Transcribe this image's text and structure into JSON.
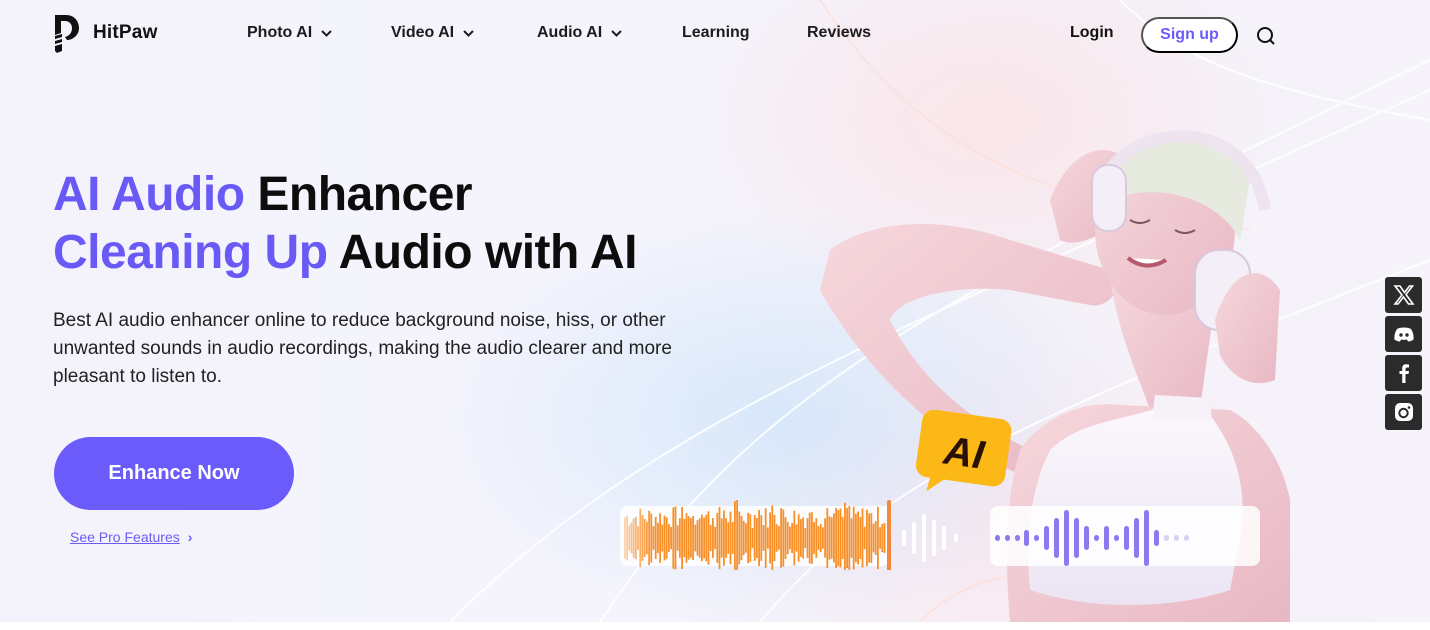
{
  "brand": {
    "name": "HitPaw",
    "accent": "#6b5bfa"
  },
  "nav": {
    "items": [
      {
        "label": "Photo AI",
        "dropdown": true
      },
      {
        "label": "Video AI",
        "dropdown": true
      },
      {
        "label": "Audio AI",
        "dropdown": true
      },
      {
        "label": "Learning",
        "dropdown": false
      },
      {
        "label": "Reviews",
        "dropdown": false
      }
    ],
    "login": "Login",
    "signup": "Sign up",
    "search_icon": "search-icon"
  },
  "hero": {
    "title_line1_accent": "AI Audio",
    "title_line1_dark": "Enhancer",
    "title_line2_accent": "Cleaning Up",
    "title_line2_dark": "Audio with AI",
    "description": "Best AI audio enhancer online to reduce background noise, hiss, or other unwanted sounds in audio recordings, making the audio clearer and more pleasant to listen to.",
    "cta": "Enhance Now",
    "pro_link": "See Pro Features",
    "badge": "AI"
  },
  "social": [
    {
      "name": "x-twitter",
      "icon": "x-icon"
    },
    {
      "name": "discord",
      "icon": "discord-icon"
    },
    {
      "name": "facebook",
      "icon": "facebook-icon"
    },
    {
      "name": "instagram",
      "icon": "instagram-icon"
    }
  ]
}
